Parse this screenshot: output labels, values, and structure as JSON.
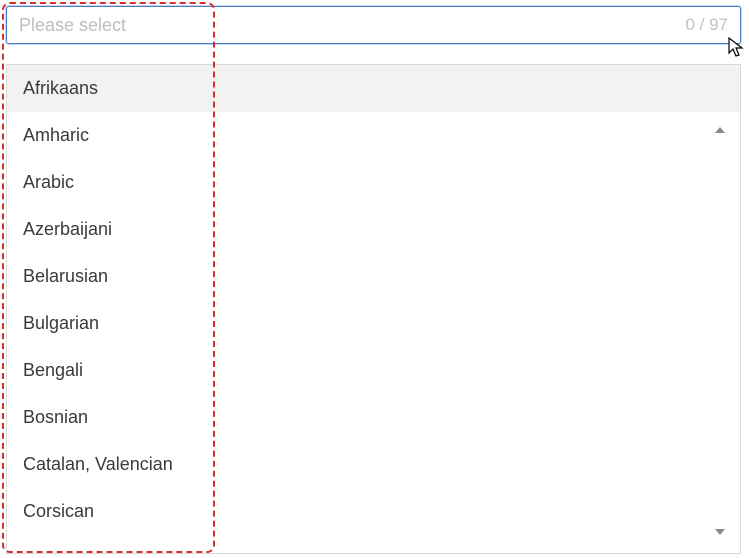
{
  "select": {
    "placeholder": "Please select",
    "counter": "0 / 97"
  },
  "options": [
    "Afrikaans",
    "Amharic",
    "Arabic",
    "Azerbaijani",
    "Belarusian",
    "Bulgarian",
    "Bengali",
    "Bosnian",
    "Catalan, Valencian",
    "Corsican"
  ]
}
